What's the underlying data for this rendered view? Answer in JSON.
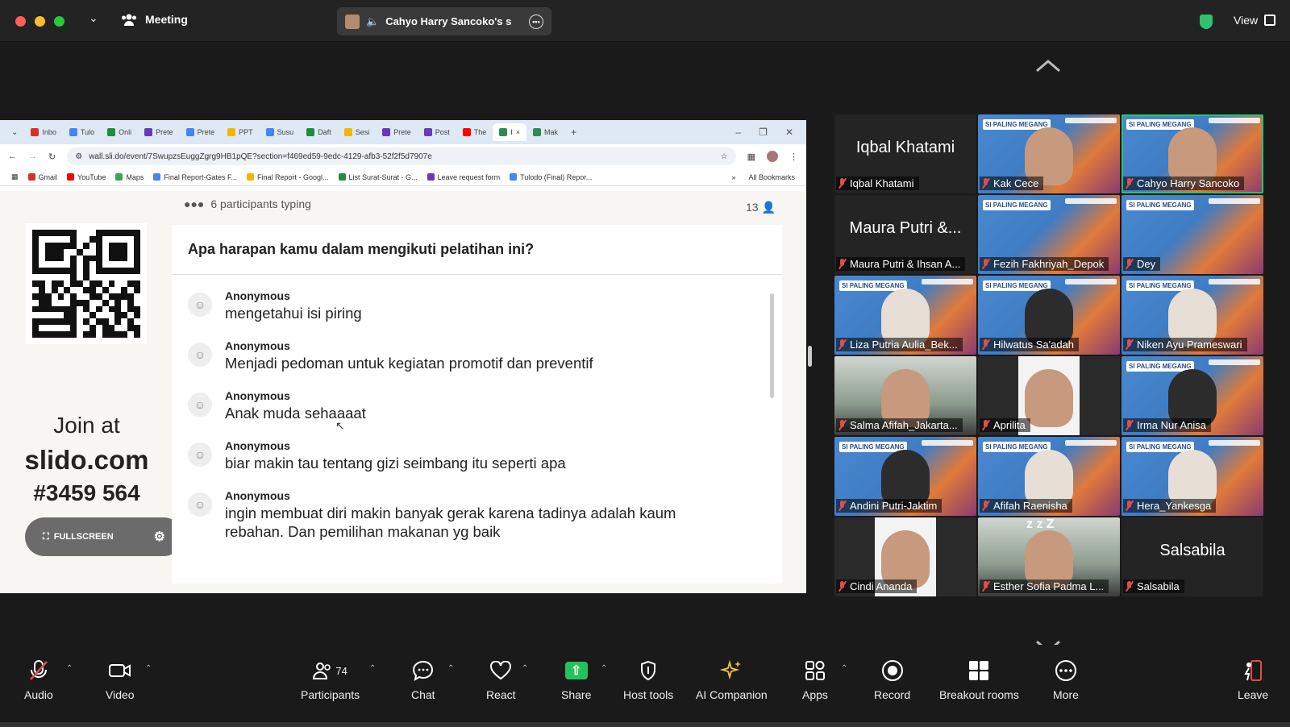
{
  "topbar": {
    "meeting_label": "Meeting",
    "share_label": "Cahyo Harry Sancoko's s",
    "view_label": "View"
  },
  "browser": {
    "tabs": [
      {
        "label": "Inbo",
        "color": "#d93025"
      },
      {
        "label": "Tulo",
        "color": "#4285f4"
      },
      {
        "label": "Onli",
        "color": "#1e8e3e"
      },
      {
        "label": "Prete",
        "color": "#673ab7"
      },
      {
        "label": "Prete",
        "color": "#4285f4"
      },
      {
        "label": "PPT",
        "color": "#f4b400"
      },
      {
        "label": "Susu",
        "color": "#4285f4"
      },
      {
        "label": "Daft",
        "color": "#1e8e3e"
      },
      {
        "label": "Sesi",
        "color": "#f4b400"
      },
      {
        "label": "Prete",
        "color": "#673ab7"
      },
      {
        "label": "Post",
        "color": "#673ab7"
      },
      {
        "label": "The",
        "color": "#ff0000"
      },
      {
        "label": "I",
        "color": "#2e8b57",
        "active": true
      },
      {
        "label": "Mak",
        "color": "#2e8b57"
      }
    ],
    "url": "wall.sli.do/event/7SwupzsEuggZgrg9HB1pQE?section=f469ed59-9edc-4129-afb3-52f2f5d7907e",
    "bookmarks": [
      {
        "label": "Gmail",
        "color": "#d93025"
      },
      {
        "label": "YouTube",
        "color": "#ff0000"
      },
      {
        "label": "Maps",
        "color": "#34a853"
      },
      {
        "label": "Final Report-Gates F...",
        "color": "#4285f4"
      },
      {
        "label": "Final Report - Googl...",
        "color": "#f4b400"
      },
      {
        "label": "List Surat-Surat - G...",
        "color": "#1e8e3e"
      },
      {
        "label": "Leave request form",
        "color": "#673ab7"
      },
      {
        "label": "Tulodo (Final) Repor...",
        "color": "#4285f4"
      }
    ],
    "all_bookmarks": "All Bookmarks"
  },
  "slido": {
    "typing": "6 participants typing",
    "count": "13",
    "join_line1": "Join at",
    "join_line2": "slido.com",
    "join_line3": "#3459 564",
    "fullscreen": "FULLSCREEN",
    "question": "Apa harapan kamu dalam mengikuti pelatihan ini?",
    "responses": [
      {
        "name": "Anonymous",
        "text": "mengetahui isi piring"
      },
      {
        "name": "Anonymous",
        "text": "Menjadi pedoman untuk kegiatan promotif dan preventif"
      },
      {
        "name": "Anonymous",
        "text": "Anak muda sehaaaat"
      },
      {
        "name": "Anonymous",
        "text": "biar makin tau tentang gizi seimbang itu seperti apa"
      },
      {
        "name": "Anonymous",
        "text": "ingin membuat diri makin banyak gerak karena tadinya adalah kaum rebahan. Dan pemilihan makanan yg baik"
      }
    ]
  },
  "gallery": {
    "poster_text": "SI PALING MEGANG",
    "tiles": [
      {
        "name": "Iqbal Khatami",
        "big": "Iqbal Khatami",
        "type": "name"
      },
      {
        "name": "Kak Cece",
        "type": "poster",
        "face": "skin"
      },
      {
        "name": "Cahyo Harry Sancoko",
        "type": "poster",
        "face": "skin",
        "active": true
      },
      {
        "name": "Maura Putri & Ihsan A...",
        "big": "Maura Putri &...",
        "type": "name"
      },
      {
        "name": "Fezih Fakhriyah_Depok",
        "type": "poster",
        "face": "none"
      },
      {
        "name": "Dey",
        "type": "poster",
        "face": "none"
      },
      {
        "name": "Liza Putria Aulia_Bek...",
        "type": "poster",
        "face": "hijab"
      },
      {
        "name": "Hilwatus Sa'adah",
        "type": "poster",
        "face": "dark"
      },
      {
        "name": "Niken Ayu Prameswari",
        "type": "poster",
        "face": "hijab"
      },
      {
        "name": "Salma Afifah_Jakarta...",
        "type": "room",
        "face": "skin"
      },
      {
        "name": "Aprilita",
        "type": "white",
        "face": "skin"
      },
      {
        "name": "Irma Nur Anisa",
        "type": "poster",
        "face": "dark"
      },
      {
        "name": "Andini Putri-Jaktim",
        "type": "poster",
        "face": "dark"
      },
      {
        "name": "Afifah Raenisha",
        "type": "poster",
        "face": "hijab"
      },
      {
        "name": "Hera_Yankesga",
        "type": "poster",
        "face": "hijab"
      },
      {
        "name": "Cindi Ananda",
        "type": "white",
        "face": "skin"
      },
      {
        "name": "Esther Sofia Padma L...",
        "type": "room",
        "face": "skin",
        "zzz": "z z Z"
      },
      {
        "name": "Salsabila",
        "big": "Salsabila",
        "type": "name"
      }
    ]
  },
  "toolbar": {
    "audio": "Audio",
    "video": "Video",
    "participants": "Participants",
    "participant_count": "74",
    "chat": "Chat",
    "react": "React",
    "share": "Share",
    "host_tools": "Host tools",
    "ai_companion": "AI Companion",
    "apps": "Apps",
    "record": "Record",
    "breakout_rooms": "Breakout rooms",
    "more": "More",
    "leave": "Leave"
  }
}
